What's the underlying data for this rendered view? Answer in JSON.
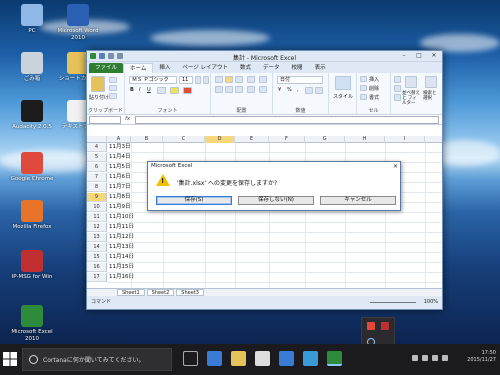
{
  "desktop": {
    "icons": [
      {
        "label": "PC",
        "name": "pc-desktop-icon",
        "color": "#8fb7e8"
      },
      {
        "label": "Microsoft Word 2010",
        "name": "word-desktop-icon",
        "color": "#2b5fb4"
      },
      {
        "label": "ごみ箱",
        "name": "recycle-bin-desktop-icon",
        "color": "#c9d3dc"
      },
      {
        "label": "ショートカット",
        "name": "folder-shortcut-desktop-icon",
        "color": "#e6c35a"
      },
      {
        "label": "Audacity 2.0.5",
        "name": "audacity-desktop-icon",
        "color": "#1b1b1b"
      },
      {
        "label": "テキスト文書",
        "name": "text-document-desktop-icon",
        "color": "#f2f2f2"
      },
      {
        "label": "Google Chrome",
        "name": "chrome-desktop-icon",
        "color": "#e04a3c"
      },
      {
        "label": "Mozilla Firefox",
        "name": "firefox-desktop-icon",
        "color": "#e8742a"
      },
      {
        "label": "IP-MSG for Win",
        "name": "ipmsg-desktop-icon",
        "color": "#c03030"
      },
      {
        "label": "Microsoft Excel 2010",
        "name": "excel-desktop-icon",
        "color": "#2e8b3c"
      }
    ]
  },
  "excel": {
    "title": "集計 - Microsoft Excel",
    "tabs": [
      "ファイル",
      "ホーム",
      "挿入",
      "ページ レイアウト",
      "数式",
      "データ",
      "校閲",
      "表示"
    ],
    "ribbon": {
      "clipboard": "クリップボード",
      "paste": "貼り付け",
      "font": "フォント",
      "font_name": "ＭＳ Ｐゴシック",
      "font_size": "11",
      "align": "配置",
      "number": "数値",
      "number_format": "日付",
      "style": "スタイル",
      "cells": "セル",
      "insert": "挿入",
      "delete": "削除",
      "format": "書式",
      "sort": "並べ替えと フィルター",
      "find": "検索と 選択"
    },
    "formula_bar": {
      "name_box": "",
      "fx": "fx"
    },
    "columns": [
      "A",
      "B",
      "C",
      "D",
      "E",
      "F",
      "G",
      "H",
      "I"
    ],
    "rows": [
      {
        "num": "4",
        "a": "11月3日"
      },
      {
        "num": "5",
        "a": "11月4日"
      },
      {
        "num": "6",
        "a": "11月5日"
      },
      {
        "num": "7",
        "a": "11月6日"
      },
      {
        "num": "8",
        "a": "11月7日"
      },
      {
        "num": "9",
        "a": "11月8日"
      },
      {
        "num": "10",
        "a": "11月9日"
      },
      {
        "num": "11",
        "a": "11月10日"
      },
      {
        "num": "12",
        "a": "11月11日"
      },
      {
        "num": "13",
        "a": "11月12日"
      },
      {
        "num": "14",
        "a": "11月13日"
      },
      {
        "num": "15",
        "a": "11月14日"
      },
      {
        "num": "16",
        "a": "11月15日"
      },
      {
        "num": "17",
        "a": "11月16日"
      }
    ],
    "sheets": [
      "Sheet1",
      "Sheet2",
      "Sheet3"
    ],
    "status": "コマンド",
    "zoom": "100%"
  },
  "dialog": {
    "title": "Microsoft Excel",
    "message": "'集計.xlsx' への変更を保存しますか?",
    "save": "保存(S)",
    "dont_save": "保存しない(N)",
    "cancel": "キャンセル"
  },
  "taskbar": {
    "cortana_placeholder": "Cortanaに何か聞いてみてください。",
    "time": "17:50",
    "date": "2015/11/27"
  }
}
